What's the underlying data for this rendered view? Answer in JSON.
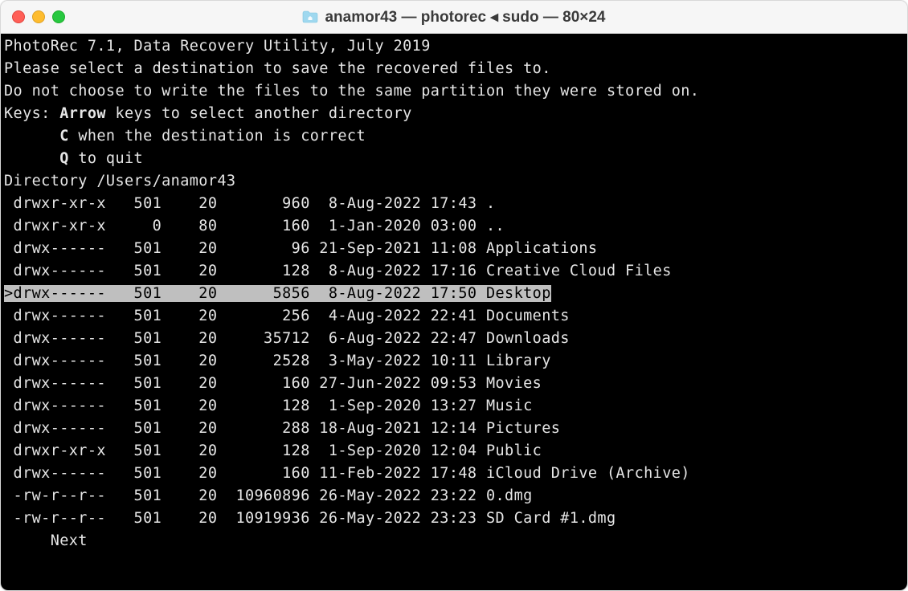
{
  "window": {
    "title": "anamor43 — photorec ◂ sudo — 80×24"
  },
  "app": {
    "header": "PhotoRec 7.1, Data Recovery Utility, July 2019",
    "prompt_line1": "Please select a destination to save the recovered files to.",
    "prompt_line2": "Do not choose to write the files to the same partition they were stored on.",
    "keys_label": "Keys: ",
    "keys_arrow_bold": "Arrow",
    "keys_arrow_rest": " keys to select another directory",
    "keys_c_bold": "C",
    "keys_c_rest": " when the destination is correct",
    "keys_q_bold": "Q",
    "keys_q_rest": " to quit",
    "cwd_label": "Directory ",
    "cwd_path": "/Users/anamor43",
    "entries": [
      {
        "perm": "drwxr-xr-x",
        "uid": "501",
        "gid": "20",
        "size": "960",
        "date": " 8-Aug-2022",
        "time": "17:43",
        "name": ".",
        "selected": false
      },
      {
        "perm": "drwxr-xr-x",
        "uid": "0",
        "gid": "80",
        "size": "160",
        "date": " 1-Jan-2020",
        "time": "03:00",
        "name": "..",
        "selected": false
      },
      {
        "perm": "drwx------",
        "uid": "501",
        "gid": "20",
        "size": "96",
        "date": "21-Sep-2021",
        "time": "11:08",
        "name": "Applications",
        "selected": false
      },
      {
        "perm": "drwx------",
        "uid": "501",
        "gid": "20",
        "size": "128",
        "date": " 8-Aug-2022",
        "time": "17:16",
        "name": "Creative Cloud Files",
        "selected": false
      },
      {
        "perm": "drwx------",
        "uid": "501",
        "gid": "20",
        "size": "5856",
        "date": " 8-Aug-2022",
        "time": "17:50",
        "name": "Desktop",
        "selected": true
      },
      {
        "perm": "drwx------",
        "uid": "501",
        "gid": "20",
        "size": "256",
        "date": " 4-Aug-2022",
        "time": "22:41",
        "name": "Documents",
        "selected": false
      },
      {
        "perm": "drwx------",
        "uid": "501",
        "gid": "20",
        "size": "35712",
        "date": " 6-Aug-2022",
        "time": "22:47",
        "name": "Downloads",
        "selected": false
      },
      {
        "perm": "drwx------",
        "uid": "501",
        "gid": "20",
        "size": "2528",
        "date": " 3-May-2022",
        "time": "10:11",
        "name": "Library",
        "selected": false
      },
      {
        "perm": "drwx------",
        "uid": "501",
        "gid": "20",
        "size": "160",
        "date": "27-Jun-2022",
        "time": "09:53",
        "name": "Movies",
        "selected": false
      },
      {
        "perm": "drwx------",
        "uid": "501",
        "gid": "20",
        "size": "128",
        "date": " 1-Sep-2020",
        "time": "13:27",
        "name": "Music",
        "selected": false
      },
      {
        "perm": "drwx------",
        "uid": "501",
        "gid": "20",
        "size": "288",
        "date": "18-Aug-2021",
        "time": "12:14",
        "name": "Pictures",
        "selected": false
      },
      {
        "perm": "drwxr-xr-x",
        "uid": "501",
        "gid": "20",
        "size": "128",
        "date": " 1-Sep-2020",
        "time": "12:04",
        "name": "Public",
        "selected": false
      },
      {
        "perm": "drwx------",
        "uid": "501",
        "gid": "20",
        "size": "160",
        "date": "11-Feb-2022",
        "time": "17:48",
        "name": "iCloud Drive (Archive)",
        "selected": false
      },
      {
        "perm": "-rw-r--r--",
        "uid": "501",
        "gid": "20",
        "size": "10960896",
        "date": "26-May-2022",
        "time": "23:22",
        "name": "0.dmg",
        "selected": false
      },
      {
        "perm": "-rw-r--r--",
        "uid": "501",
        "gid": "20",
        "size": "10919936",
        "date": "26-May-2022",
        "time": "23:23",
        "name": "SD Card #1.dmg",
        "selected": false
      }
    ],
    "footer_next": "Next"
  }
}
